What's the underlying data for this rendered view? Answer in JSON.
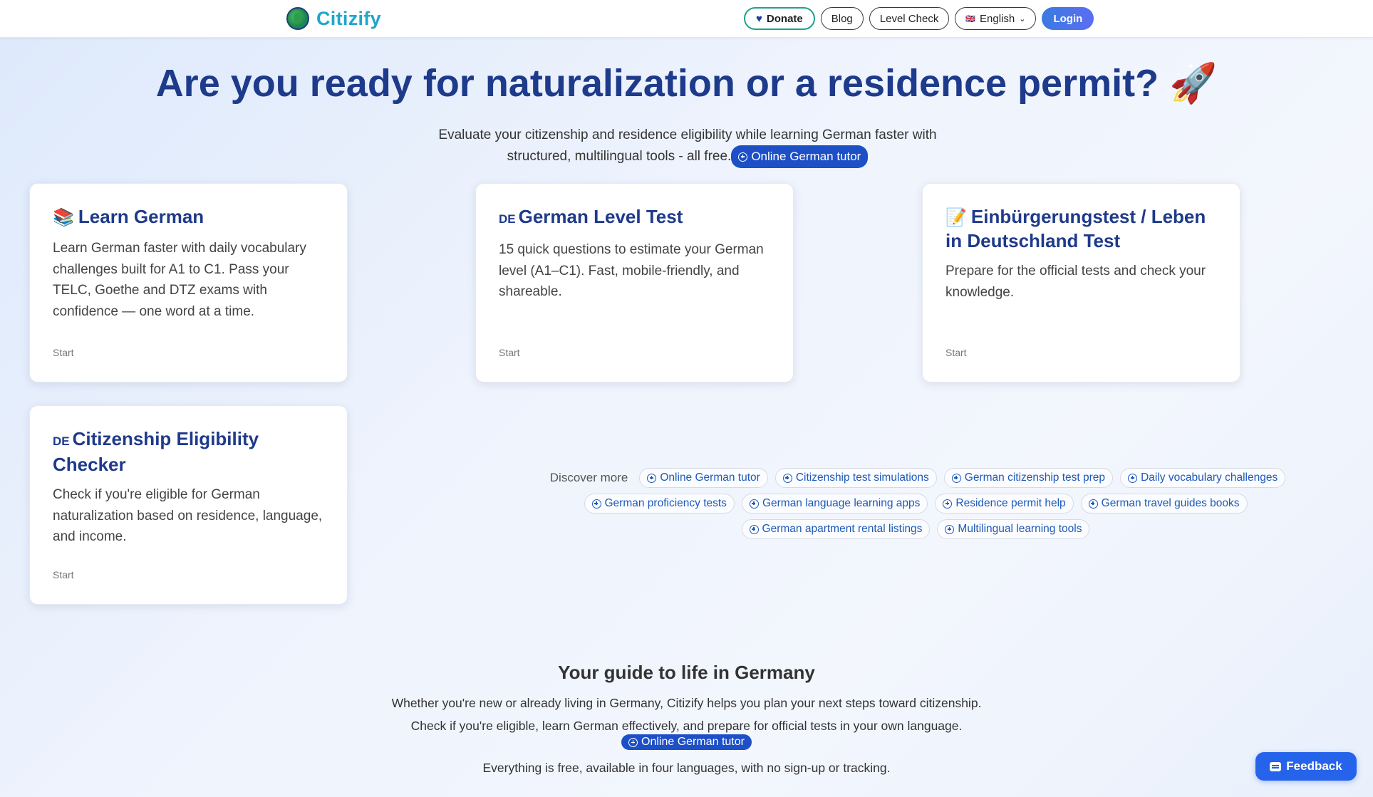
{
  "header": {
    "logo_text": "Citizify",
    "nav": {
      "donate": "Donate",
      "blog": "Blog",
      "level_check": "Level Check",
      "language": "English",
      "login": "Login"
    }
  },
  "hero": {
    "title": "Are you ready for naturalization or a residence permit? 🚀",
    "subtitle_line1": "Evaluate your citizenship and residence eligibility while learning German faster with",
    "subtitle_line2": "structured, multilingual tools - all free.",
    "tutor_chip": "Online German tutor"
  },
  "cards": [
    {
      "icon": "📚",
      "title": "Learn German",
      "text": "Learn German faster with daily vocabulary challenges built for A1 to C1. Pass your TELC, Goethe and DTZ exams with confidence — one word at a time.",
      "start": "Start"
    },
    {
      "icon": "DE",
      "title": "German Level Test",
      "text": "15 quick questions to estimate your German level (A1–C1). Fast, mobile-friendly, and shareable.",
      "start": "Start"
    },
    {
      "icon": "📝",
      "title": "Einbürgerungstest / Leben in Deutschland Test",
      "text": "Prepare for the official tests and check your knowledge.",
      "start": "Start"
    },
    {
      "icon": "DE",
      "title": "Citizenship Eligibility Checker",
      "text": "Check if you're eligible for German naturalization based on residence, language, and income.",
      "start": "Start"
    }
  ],
  "discover": {
    "label": "Discover more",
    "chips": [
      "Online German tutor",
      "Citizenship test simulations",
      "German citizenship test prep",
      "Daily vocabulary challenges",
      "German proficiency tests",
      "German language learning apps",
      "Residence permit help",
      "German travel guides books",
      "German apartment rental listings",
      "Multilingual learning tools"
    ]
  },
  "guide": {
    "title": "Your guide to life in Germany",
    "line1": "Whether you're new or already living in Germany, Citizify helps you plan your next steps toward citizenship.",
    "line2": "Check if you're eligible, learn German effectively, and prepare for official tests in your own language.",
    "tutor_chip": "Online German tutor",
    "line3": "Everything is free, available in four languages, with no sign-up or tracking."
  },
  "feedback": "Feedback"
}
